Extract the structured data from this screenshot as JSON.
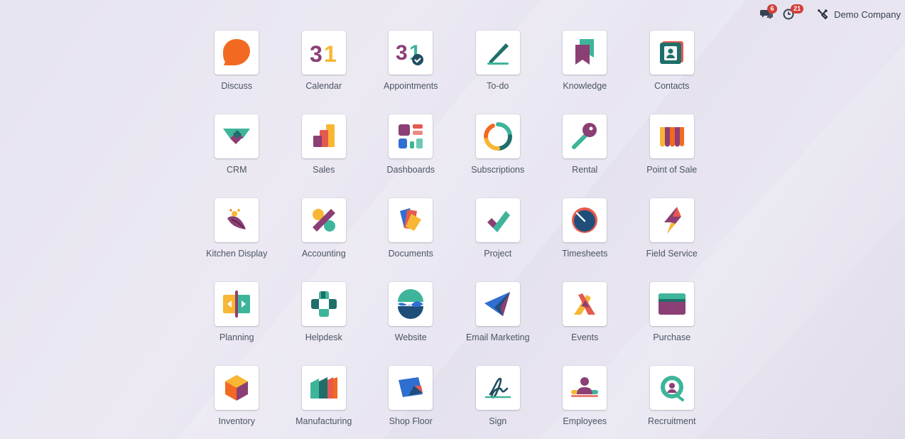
{
  "systray": {
    "messages_badge": "6",
    "activities_badge": "21",
    "company_name": "Demo Company",
    "icons": [
      "chat-bubbles-icon",
      "clock-icon",
      "tools-icon"
    ]
  },
  "apps": [
    {
      "label": "Discuss",
      "icon": "discuss-icon"
    },
    {
      "label": "Calendar",
      "icon": "calendar-icon"
    },
    {
      "label": "Appointments",
      "icon": "appointments-icon"
    },
    {
      "label": "To-do",
      "icon": "todo-icon"
    },
    {
      "label": "Knowledge",
      "icon": "knowledge-icon"
    },
    {
      "label": "Contacts",
      "icon": "contacts-icon"
    },
    {
      "label": "CRM",
      "icon": "crm-icon"
    },
    {
      "label": "Sales",
      "icon": "sales-icon"
    },
    {
      "label": "Dashboards",
      "icon": "dashboards-icon"
    },
    {
      "label": "Subscriptions",
      "icon": "subscriptions-icon"
    },
    {
      "label": "Rental",
      "icon": "rental-icon"
    },
    {
      "label": "Point of Sale",
      "icon": "point-of-sale-icon"
    },
    {
      "label": "Kitchen Display",
      "icon": "kitchen-display-icon"
    },
    {
      "label": "Accounting",
      "icon": "accounting-icon"
    },
    {
      "label": "Documents",
      "icon": "documents-icon"
    },
    {
      "label": "Project",
      "icon": "project-icon"
    },
    {
      "label": "Timesheets",
      "icon": "timesheets-icon"
    },
    {
      "label": "Field Service",
      "icon": "field-service-icon"
    },
    {
      "label": "Planning",
      "icon": "planning-icon"
    },
    {
      "label": "Helpdesk",
      "icon": "helpdesk-icon"
    },
    {
      "label": "Website",
      "icon": "website-icon"
    },
    {
      "label": "Email Marketing",
      "icon": "email-marketing-icon"
    },
    {
      "label": "Events",
      "icon": "events-icon"
    },
    {
      "label": "Purchase",
      "icon": "purchase-icon"
    },
    {
      "label": "Inventory",
      "icon": "inventory-icon"
    },
    {
      "label": "Manufacturing",
      "icon": "manufacturing-icon"
    },
    {
      "label": "Shop Floor",
      "icon": "shop-floor-icon"
    },
    {
      "label": "Sign",
      "icon": "sign-icon"
    },
    {
      "label": "Employees",
      "icon": "employees-icon"
    },
    {
      "label": "Recruitment",
      "icon": "recruitment-icon"
    }
  ],
  "colors": {
    "orange": "#f26a21",
    "purple": "#8b3f74",
    "teal": "#3eb59a",
    "dark_teal": "#1f6e6a",
    "yellow": "#f7b734",
    "blue": "#2f6fd1",
    "red": "#e45a4f",
    "badge": "#d23f3a"
  }
}
